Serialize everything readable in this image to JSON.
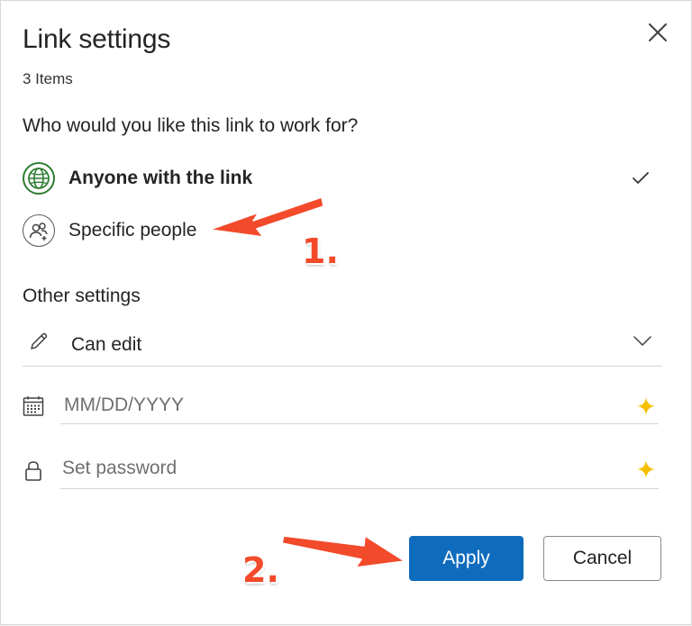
{
  "dialog": {
    "title": "Link settings",
    "item_count": "3 Items",
    "close_icon": "close-icon"
  },
  "audience": {
    "question": "Who would you like this link to work for?",
    "options": [
      {
        "label": "Anyone with the link",
        "icon": "globe-icon",
        "selected": true
      },
      {
        "label": "Specific people",
        "icon": "people-icon",
        "selected": false
      }
    ]
  },
  "other_settings": {
    "heading": "Other settings",
    "permission": {
      "value": "Can edit",
      "icon": "pencil-icon"
    },
    "expiry": {
      "placeholder": "MM/DD/YYYY",
      "icon": "calendar-icon",
      "premium_icon": "sparkle-icon"
    },
    "password": {
      "placeholder": "Set password",
      "icon": "lock-icon",
      "premium_icon": "sparkle-icon"
    }
  },
  "actions": {
    "apply_label": "Apply",
    "cancel_label": "Cancel"
  },
  "annotations": {
    "step1": "1.",
    "step2": "2."
  },
  "colors": {
    "accent": "#0f6cbd",
    "globe": "#2e7d32",
    "premium": "#f5c000",
    "annotation": "#f24a2a"
  }
}
